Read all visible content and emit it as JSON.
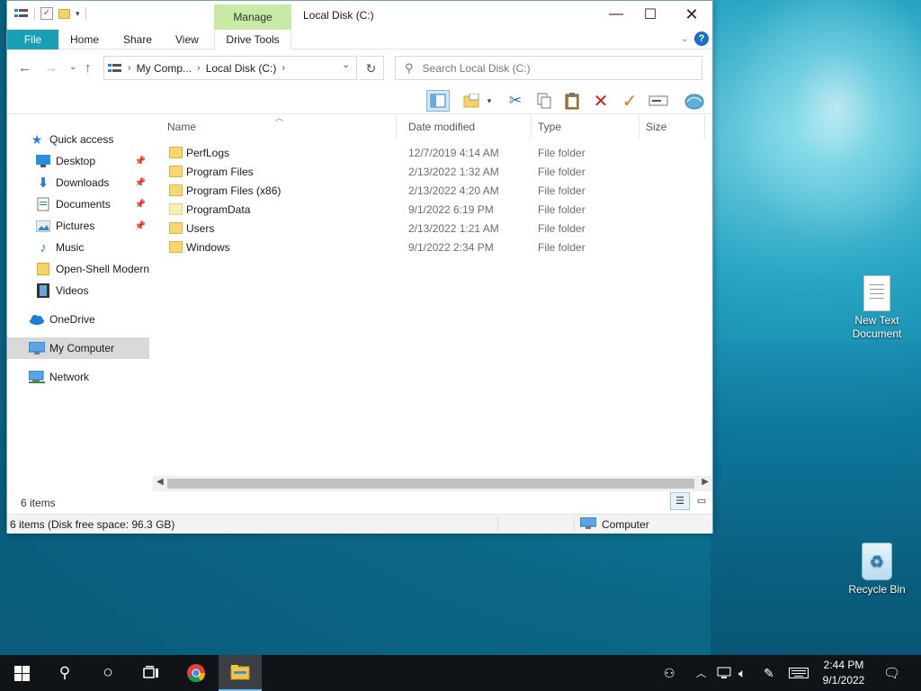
{
  "window": {
    "title": "Local Disk (C:)",
    "context_tab": "Manage",
    "ribbon_tabs": [
      "File",
      "Home",
      "Share",
      "View",
      "Drive Tools"
    ],
    "help_label": "?"
  },
  "address": {
    "segments": [
      "My Comp...",
      "Local Disk (C:)"
    ],
    "search_placeholder": "Search Local Disk (C:)"
  },
  "nav": {
    "quick_access": "Quick access",
    "items": [
      {
        "label": "Desktop",
        "icon": "desktop-icon",
        "pinned": true
      },
      {
        "label": "Downloads",
        "icon": "download-arrow-icon",
        "pinned": true
      },
      {
        "label": "Documents",
        "icon": "documents-icon",
        "pinned": true
      },
      {
        "label": "Pictures",
        "icon": "pictures-icon",
        "pinned": true
      },
      {
        "label": "Music",
        "icon": "music-note-icon",
        "pinned": false
      },
      {
        "label": "Open-Shell Modern",
        "icon": "folder-icon",
        "pinned": false
      },
      {
        "label": "Videos",
        "icon": "film-icon",
        "pinned": false
      }
    ],
    "onedrive": "OneDrive",
    "my_computer": "My Computer",
    "network": "Network"
  },
  "columns": {
    "name": "Name",
    "date": "Date modified",
    "type": "Type",
    "size": "Size"
  },
  "files": [
    {
      "name": "PerfLogs",
      "date": "12/7/2019 4:14 AM",
      "type": "File folder"
    },
    {
      "name": "Program Files",
      "date": "2/13/2022 1:32 AM",
      "type": "File folder"
    },
    {
      "name": "Program Files (x86)",
      "date": "2/13/2022 4:20 AM",
      "type": "File folder"
    },
    {
      "name": "ProgramData",
      "date": "9/1/2022 6:19 PM",
      "type": "File folder"
    },
    {
      "name": "Users",
      "date": "2/13/2022 1:21 AM",
      "type": "File folder"
    },
    {
      "name": "Windows",
      "date": "9/1/2022 2:34 PM",
      "type": "File folder"
    }
  ],
  "items_count": "6 items",
  "status": {
    "left": "6 items (Disk free space: 96.3 GB)",
    "right": "Computer"
  },
  "desktop": {
    "icons": [
      {
        "label_line1": "New Text",
        "label_line2": "Document"
      },
      {
        "label_line1": "Recycle Bin",
        "label_line2": ""
      }
    ]
  },
  "taskbar": {
    "time": "2:44 PM",
    "date": "9/1/2022"
  },
  "colors": {
    "file_tab": "#19a0b4",
    "manage_tab": "#c8eaa6",
    "taskbar": "#101418",
    "selection": "#d9d9d9"
  }
}
